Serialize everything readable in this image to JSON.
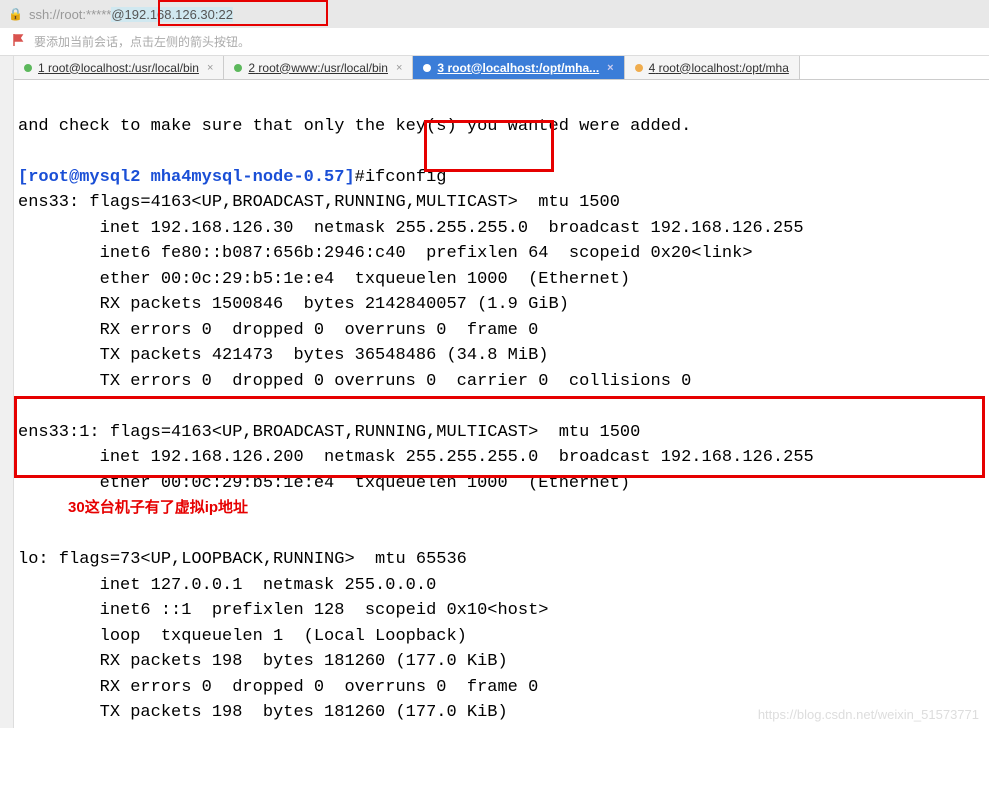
{
  "address_bar": {
    "ssh_prefix": "ssh://root:*****",
    "ssh_host": "@192.168.126.30:22"
  },
  "hint_bar": {
    "text": "要添加当前会话，点击左侧的箭头按钮。"
  },
  "tabs": [
    {
      "num": "1",
      "label": "root@localhost:/usr/local/bin",
      "active": false,
      "dot": "green"
    },
    {
      "num": "2",
      "label": "root@www:/usr/local/bin",
      "active": false,
      "dot": "green"
    },
    {
      "num": "3",
      "label": "root@localhost:/opt/mha...",
      "active": true,
      "dot": "white"
    },
    {
      "num": "4",
      "label": "root@localhost:/opt/mha",
      "active": false,
      "dot": "orange"
    }
  ],
  "terminal": {
    "line0": "and check to make sure that only the key(s) you wanted were added.",
    "prompt_user": "[root@mysql2 mha4mysql-node-0.57]",
    "prompt_hash": "#",
    "command": "ifconfig",
    "ens33_header": "ens33: flags=4163<UP,BROADCAST,RUNNING,MULTICAST>  mtu 1500",
    "ens33_l1": "        inet 192.168.126.30  netmask 255.255.255.0  broadcast 192.168.126.255",
    "ens33_l2": "        inet6 fe80::b087:656b:2946:c40  prefixlen 64  scopeid 0x20<link>",
    "ens33_l3": "        ether 00:0c:29:b5:1e:e4  txqueuelen 1000  (Ethernet)",
    "ens33_l4": "        RX packets 1500846  bytes 2142840057 (1.9 GiB)",
    "ens33_l5": "        RX errors 0  dropped 0  overruns 0  frame 0",
    "ens33_l6": "        TX packets 421473  bytes 36548486 (34.8 MiB)",
    "ens33_l7": "        TX errors 0  dropped 0 overruns 0  carrier 0  collisions 0",
    "ens33_1_header": "ens33:1: flags=4163<UP,BROADCAST,RUNNING,MULTICAST>  mtu 1500",
    "ens33_1_l1": "        inet 192.168.126.200  netmask 255.255.255.0  broadcast 192.168.126.255",
    "ens33_1_l2": "        ether 00:0c:29:b5:1e:e4  txqueuelen 1000  (Ethernet)",
    "annotation": "            30这台机子有了虚拟ip地址",
    "lo_header": "lo: flags=73<UP,LOOPBACK,RUNNING>  mtu 65536",
    "lo_l1": "        inet 127.0.0.1  netmask 255.0.0.0",
    "lo_l2": "        inet6 ::1  prefixlen 128  scopeid 0x10<host>",
    "lo_l3": "        loop  txqueuelen 1  (Local Loopback)",
    "lo_l4": "        RX packets 198  bytes 181260 (177.0 KiB)",
    "lo_l5": "        RX errors 0  dropped 0  overruns 0  frame 0",
    "lo_l6": "        TX packets 198  bytes 181260 (177.0 KiB)"
  },
  "watermark": "https://blog.csdn.net/weixin_51573771"
}
